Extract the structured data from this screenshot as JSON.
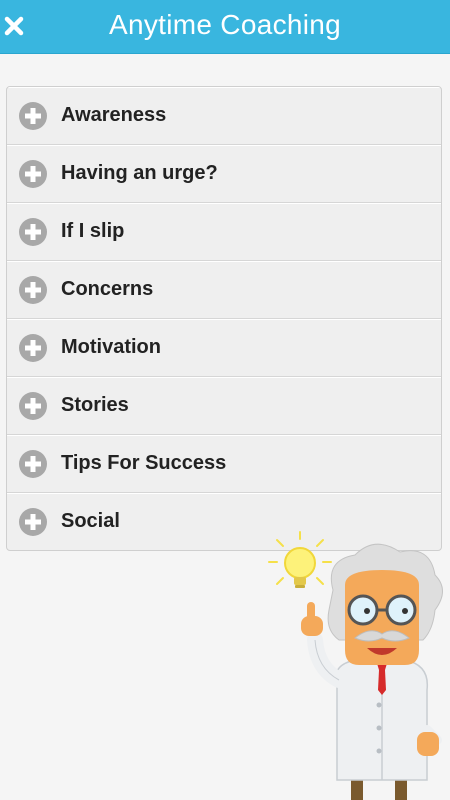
{
  "header": {
    "title": "Anytime Coaching",
    "close_icon": "close-icon"
  },
  "menu": {
    "items": [
      {
        "label": "Awareness",
        "icon": "plus-circle-icon"
      },
      {
        "label": "Having an urge?",
        "icon": "plus-circle-icon"
      },
      {
        "label": "If I slip",
        "icon": "plus-circle-icon"
      },
      {
        "label": "Concerns",
        "icon": "plus-circle-icon"
      },
      {
        "label": "Motivation",
        "icon": "plus-circle-icon"
      },
      {
        "label": "Stories",
        "icon": "plus-circle-icon"
      },
      {
        "label": "Tips For Success",
        "icon": "plus-circle-icon"
      },
      {
        "label": "Social",
        "icon": "plus-circle-icon"
      }
    ]
  },
  "colors": {
    "header_bg": "#39b6df",
    "item_bg": "#efefef",
    "icon_gray": "#a8a8a8"
  }
}
